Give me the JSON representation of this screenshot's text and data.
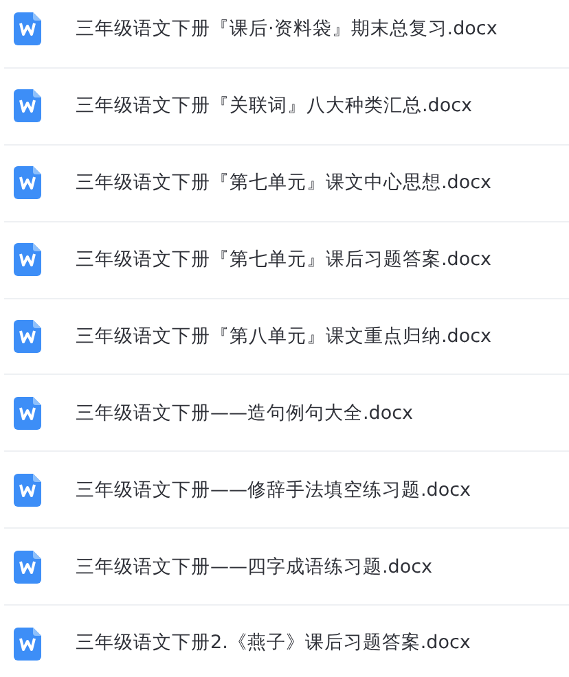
{
  "files": [
    {
      "name": "三年级语文下册『课后·资料袋』期末总复习.docx"
    },
    {
      "name": "三年级语文下册『关联词』八大种类汇总.docx"
    },
    {
      "name": "三年级语文下册『第七单元』课文中心思想.docx"
    },
    {
      "name": "三年级语文下册『第七单元』课后习题答案.docx"
    },
    {
      "name": "三年级语文下册『第八单元』课文重点归纳.docx"
    },
    {
      "name": "三年级语文下册——造句例句大全.docx"
    },
    {
      "name": "三年级语文下册——修辞手法填空练习题.docx"
    },
    {
      "name": "三年级语文下册——四字成语练习题.docx"
    },
    {
      "name": "三年级语文下册2.《燕子》课后习题答案.docx"
    }
  ]
}
